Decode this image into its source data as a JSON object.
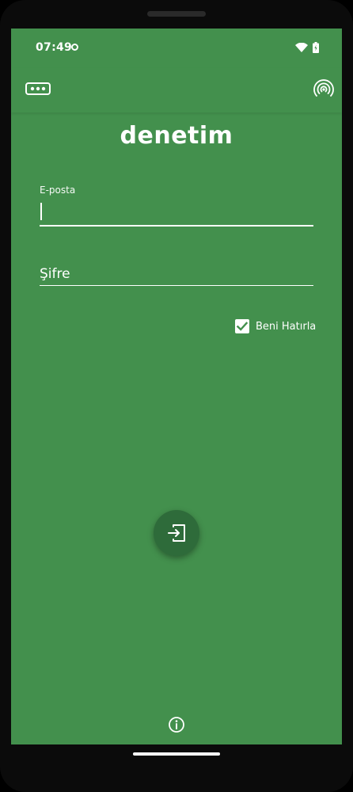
{
  "status_bar": {
    "time": "07:49"
  },
  "app_bar": {
    "left_icon": "password-icon",
    "right_icon": "nfc-icon"
  },
  "app": {
    "logo_text": "denetim"
  },
  "login_form": {
    "email_label": "E-posta",
    "email_value": "",
    "password_placeholder": "Şifre",
    "password_value": "",
    "remember_label": "Beni Hatırla",
    "remember_checked": true
  },
  "actions": {
    "login_icon": "login-icon",
    "info_icon": "info-icon"
  },
  "colors": {
    "background": "#43904d",
    "fab": "#2e6b3a",
    "foreground": "#ffffff"
  }
}
